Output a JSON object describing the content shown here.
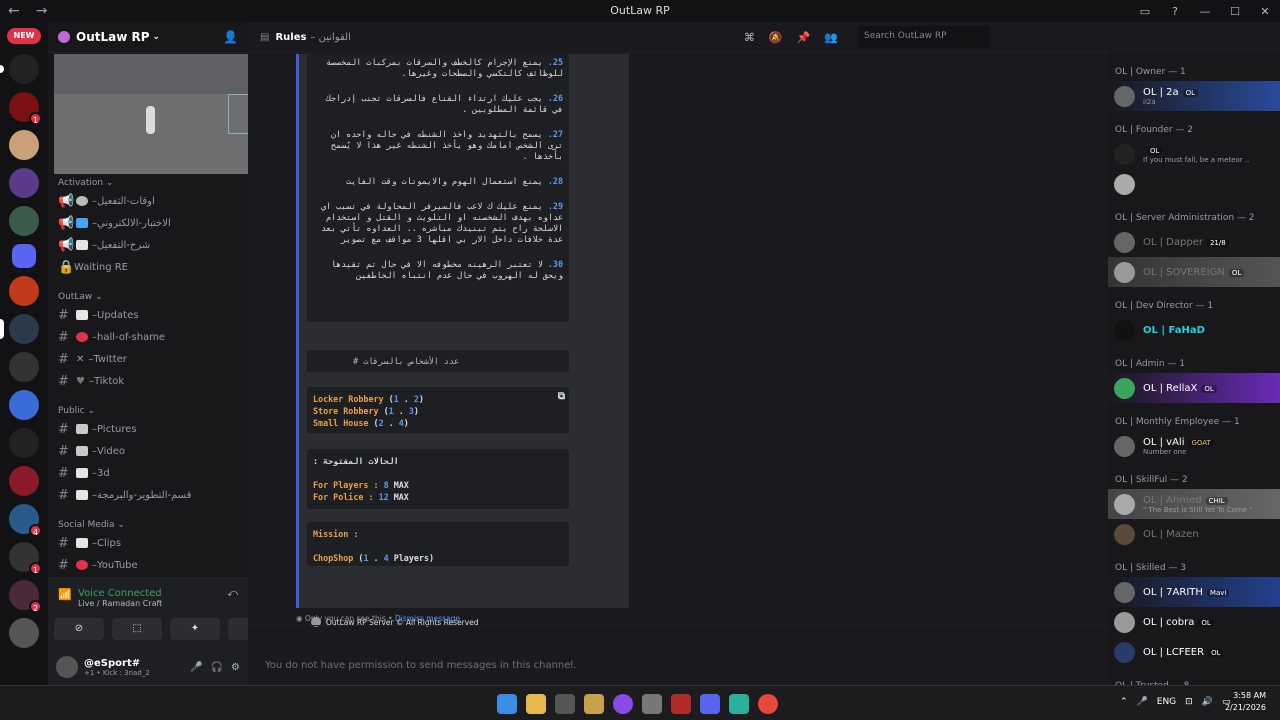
{
  "window": {
    "title": "OutLaw RP",
    "controls": [
      "▭",
      "?",
      "—",
      "☐",
      "✕"
    ]
  },
  "server_rail": {
    "new_badge": "NEW"
  },
  "guild": {
    "name": "OutLaw RP"
  },
  "channels": {
    "categories": [
      {
        "name": "Activation",
        "items": [
          {
            "label": "اوقات-التفعيل",
            "emoji_color": "#bbbbbb"
          },
          {
            "label": "الاختبار-الالكتروني",
            "emoji_color": "#47a3f3"
          },
          {
            "label": "شرح-التفعيل",
            "emoji_color": "#e5e5e5"
          },
          {
            "label": "Waiting RE",
            "emoji_color": ""
          }
        ]
      },
      {
        "name": "OutLaw",
        "items": [
          {
            "label": "Updates",
            "emoji_color": "#e6e6e6"
          },
          {
            "label": "hall-of-shame",
            "emoji_color": "#e0334a"
          },
          {
            "label": "Twitter",
            "emoji_color": "#999999"
          },
          {
            "label": "Tiktok",
            "emoji_color": "#777777"
          }
        ]
      },
      {
        "name": "Public",
        "items": [
          {
            "label": "Pictures",
            "emoji_color": "#c9c9c9"
          },
          {
            "label": "Video",
            "emoji_color": "#c9c9c9"
          },
          {
            "label": "3d",
            "emoji_color": "#e5e5e5"
          },
          {
            "label": "قسم-التطوير-والبرمجة",
            "emoji_color": "#e5e5e5"
          }
        ]
      },
      {
        "name": "Social Media",
        "items": [
          {
            "label": "Clips",
            "emoji_color": "#e5e5e5"
          },
          {
            "label": "YouTube",
            "emoji_color": "#e0334a"
          }
        ]
      }
    ]
  },
  "voice": {
    "status": "Voice Connected",
    "channel": "Live / Ramadan Craft"
  },
  "user": {
    "name": "@eSport#",
    "status": "+1 • Kick : 3nad_2"
  },
  "channel_header": {
    "name": "Rules",
    "topic": "– القوانين",
    "search_placeholder": "Search OutLaw RP"
  },
  "rules": [
    {
      "n": "25.",
      "text": "يمنع الإجرام كالخطف والسرقات بمركبات المخصصة للوظائف كالتكسي والصطحات وغيرها."
    },
    {
      "n": "26.",
      "text": "يجب عليك ارتداء القناع فالسرقات تجنب إدراجك في قائمة المطلوبين ."
    },
    {
      "n": "27.",
      "text": "يسمح بالتهديد واخذ الشنطه في حاله واحده ان ترى الشخص امامك وهو يأخذ الشنطه غير هذا لا يُسمح بأخذها ."
    },
    {
      "n": "28.",
      "text": "يمنع استعمال الهوم والايموتات وقت الفايت"
    },
    {
      "n": "29.",
      "text": "يمنع عليك ك لاعب فالسيرفر المحاولة في تسبب اي عداوه بهدف الشخصنه او التلويث و القتل و استخدام الاسلحة راح يتم تبنيدك مباشره .. العداوه تأتي بعد عدة خلافات داخل الار بي اقلها 3 مواقف مع تصوير"
    },
    {
      "n": "30.",
      "text": "لا تعتبر الرهينه مخطوفه الا في حال تم تقيدها ويحق له الهروب في حال عدم انتباه الخاطفين"
    }
  ],
  "robbery_title": "عدد الأشخاص بالسرقات #",
  "robberies": [
    {
      "name": "Locker Robbery",
      "min": "1",
      "max": "2"
    },
    {
      "name": "Store Robbery",
      "min": "1",
      "max": "3"
    },
    {
      "name": "Small House",
      "min": "2",
      "max": "4"
    }
  ],
  "open_cases": {
    "title": "الحالات المفتوحة :",
    "players_label": "For Players :",
    "players_value": "8",
    "police_label": "For Police :",
    "police_value": "12",
    "max": "MAX"
  },
  "mission": {
    "title": "Mission :",
    "name": "ChopShop",
    "min": "1",
    "max": "4",
    "unit": "Players"
  },
  "embed_footer": "OutLaw RP Server © All Rights Reserved",
  "ephemeral": {
    "text": "Only you can see this •",
    "dismiss": "Dismiss message"
  },
  "no_permission": "You do not have permission to send messages in this channel.",
  "members": [
    {
      "section": "OL | Owner — 1",
      "people": [
        {
          "name": "OL | 2a",
          "status": "ii2a",
          "badge": "OL",
          "color": "#ffffff",
          "bg": "#2a4b9b"
        }
      ]
    },
    {
      "section": "OL | Founder — 2",
      "people": [
        {
          "name": "",
          "status": "If you must fall, be a meteor ..",
          "badge": "OL",
          "color": "#d23b3b",
          "bg": ""
        },
        {
          "name": "",
          "status": "",
          "badge": "",
          "color": "#d23b3b",
          "bg": ""
        }
      ]
    },
    {
      "section": "OL | Server Administration — 2",
      "people": [
        {
          "name": "OL | Dapper",
          "status": "",
          "badge": "21/8",
          "color": "#777777",
          "bg": ""
        },
        {
          "name": "OL | SOVEREIGN",
          "status": "",
          "badge": "OL",
          "color": "#777777",
          "bg": "#444"
        }
      ]
    },
    {
      "section": "OL | Dev Director — 1",
      "people": [
        {
          "name": "OL | FaHaD",
          "status": "",
          "badge": "",
          "color": "#20d3e0",
          "bg": ""
        }
      ]
    },
    {
      "section": "OL | Admin — 1",
      "people": [
        {
          "name": "OL | RellaX",
          "status": "",
          "badge": "OL",
          "color": "#ffffff",
          "bg": "#6a2bb6"
        }
      ]
    },
    {
      "section": "OL | Monthly Employee — 1",
      "people": [
        {
          "name": "OL | vAli",
          "status": "Number one",
          "badge": "GOAT",
          "color": "#ffffff",
          "bg": ""
        }
      ]
    },
    {
      "section": "OL | SkillFul — 2",
      "people": [
        {
          "name": "OL | Ahmed",
          "status": "\" The Best is Still Yet To Come \"",
          "badge": "CHIL",
          "color": "#777777",
          "bg": "#555"
        },
        {
          "name": "OL | Mazen",
          "status": "",
          "badge": "",
          "color": "#777777",
          "bg": ""
        }
      ]
    },
    {
      "section": "OL | Skilled — 3",
      "people": [
        {
          "name": "OL | 7ARITH",
          "status": "",
          "badge": "Mavi",
          "color": "#ffffff",
          "bg": "#23408e"
        },
        {
          "name": "OL | cobra",
          "status": "",
          "badge": "OL",
          "color": "#ffffff",
          "bg": ""
        },
        {
          "name": "OL | LCFEER",
          "status": "",
          "badge": "OL",
          "color": "#ffffff",
          "bg": ""
        }
      ]
    },
    {
      "section": "OL | Trusted — 8",
      "people": []
    }
  ],
  "taskbar": {
    "lang": "ENG",
    "time": "3:58 AM",
    "date": "2/21/2026"
  },
  "colors": {
    "accent": "#5865f2",
    "online": "#3ba55c",
    "embed_bar": "#3b5bdb"
  }
}
